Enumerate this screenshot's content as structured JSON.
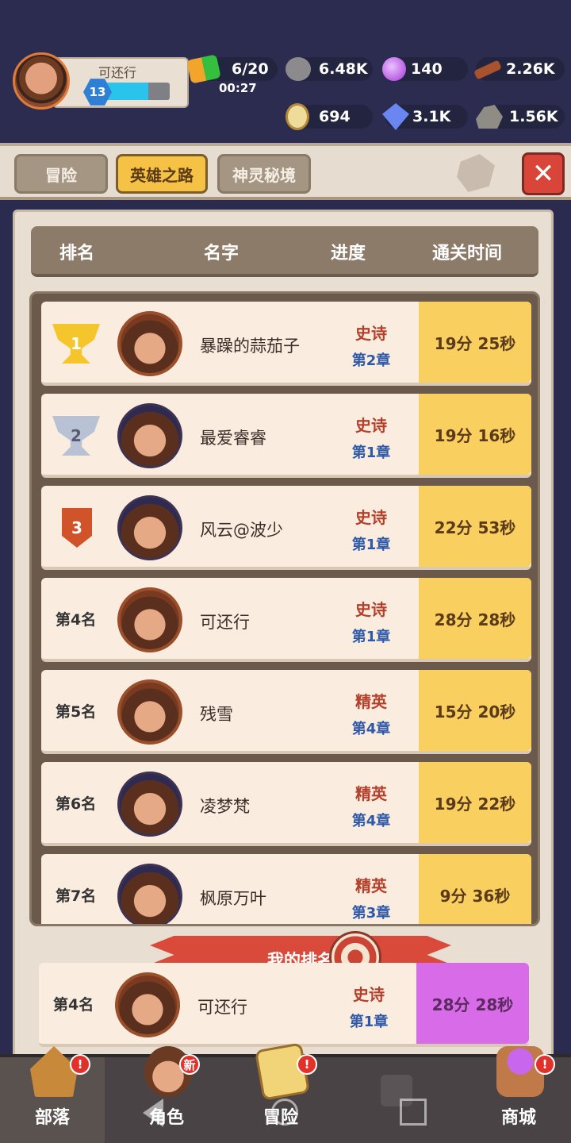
{
  "player": {
    "name": "可还行",
    "level": "13",
    "xp_fraction": 0.72
  },
  "resources": {
    "energy": "6/20",
    "energy_timer": "00:27",
    "stone": "6.48K",
    "gem_purple": "140",
    "wood": "2.26K",
    "egg": "694",
    "crystal": "3.1K",
    "ore": "1.56K"
  },
  "tabs": [
    {
      "label": "冒险"
    },
    {
      "label": "英雄之路"
    },
    {
      "label": "神灵秘境"
    }
  ],
  "table": {
    "headers": [
      "排名",
      "名字",
      "进度",
      "通关时间"
    ],
    "rows": [
      {
        "rank": "1",
        "name": "暴躁的蒜茄子",
        "difficulty": "史诗",
        "chapter": "第2章",
        "time": "19分 25秒"
      },
      {
        "rank": "2",
        "name": "最爱睿睿",
        "difficulty": "史诗",
        "chapter": "第1章",
        "time": "19分 16秒"
      },
      {
        "rank": "3",
        "name": "风云@波少",
        "difficulty": "史诗",
        "chapter": "第1章",
        "time": "22分 53秒"
      },
      {
        "rank": "第4名",
        "name": "可还行",
        "difficulty": "史诗",
        "chapter": "第1章",
        "time": "28分 28秒"
      },
      {
        "rank": "第5名",
        "name": "残雪",
        "difficulty": "精英",
        "chapter": "第4章",
        "time": "15分 20秒"
      },
      {
        "rank": "第6名",
        "name": "凌梦梵",
        "difficulty": "精英",
        "chapter": "第4章",
        "time": "19分 22秒"
      },
      {
        "rank": "第7名",
        "name": "枫原万叶",
        "difficulty": "精英",
        "chapter": "第3章",
        "time": "9分 36秒"
      }
    ]
  },
  "my_rank": {
    "banner": "我的排名",
    "rank": "第4名",
    "name": "可还行",
    "difficulty": "史诗",
    "chapter": "第1章",
    "time": "28分 28秒"
  },
  "nav": [
    {
      "label": "部落",
      "badge": "!"
    },
    {
      "label": "角色",
      "badge": "新"
    },
    {
      "label": "冒险",
      "badge": "!"
    },
    {
      "label": ""
    },
    {
      "label": "商城",
      "badge": "!"
    }
  ],
  "colors": {
    "time_cell": "#f9cf60",
    "my_time_cell": "#d86be8",
    "active_tab": "#f6c245",
    "close_button": "#d94538"
  }
}
